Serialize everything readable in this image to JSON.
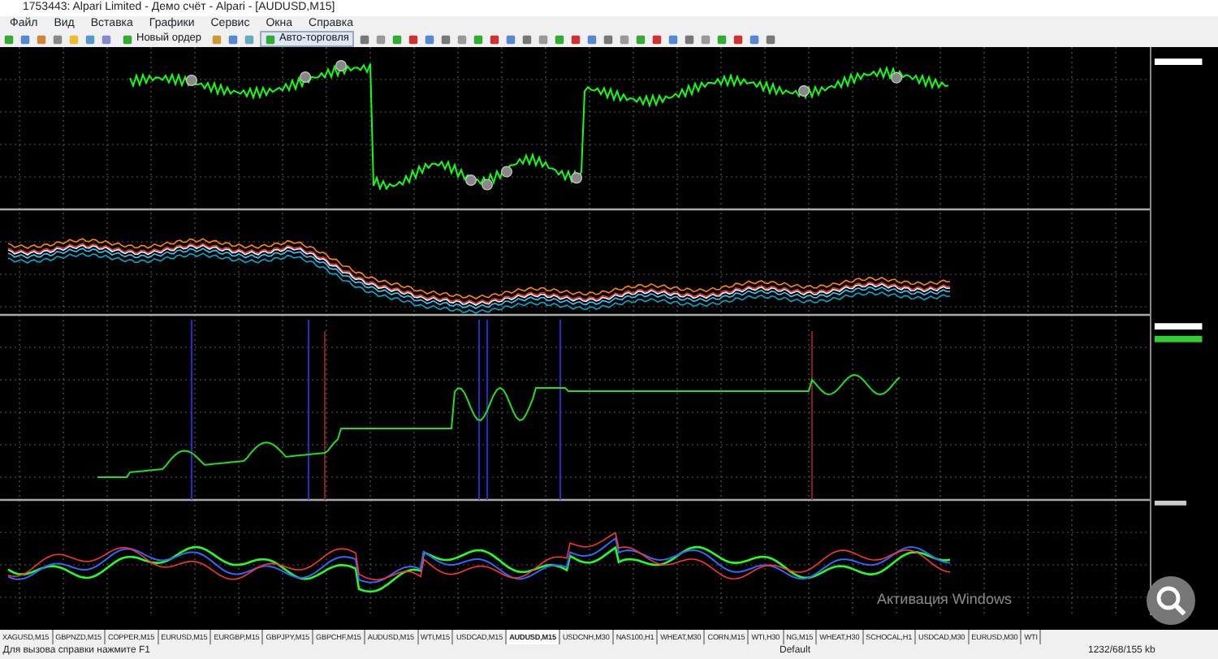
{
  "window": {
    "title": "1753443: Alpari Limited - Демо счёт - Alpari - [AUDUSD,M15]"
  },
  "menu": [
    "Файл",
    "Вид",
    "Вставка",
    "Графики",
    "Сервис",
    "Окна",
    "Справка"
  ],
  "toolbar": {
    "new_order": "Новый ордер",
    "auto_trading": "Авто-торговля",
    "auto_trading_on": true
  },
  "chart": {
    "panes": [
      {
        "kind": "price"
      },
      {
        "kind": "bands"
      },
      {
        "kind": "equity"
      },
      {
        "kind": "oscillator"
      }
    ],
    "overlay_text": "Активация Windows"
  },
  "tabs": [
    {
      "label": "XAGUSD,M15",
      "selected": false
    },
    {
      "label": "GBPNZD,M15",
      "selected": false
    },
    {
      "label": "COPPER,M15",
      "selected": false
    },
    {
      "label": "EURUSD,M15",
      "selected": false
    },
    {
      "label": "EURGBP,M15",
      "selected": false
    },
    {
      "label": "GBPJPY,M15",
      "selected": false
    },
    {
      "label": "GBPCHF,M15",
      "selected": false
    },
    {
      "label": "AUDUSD,M15",
      "selected": false
    },
    {
      "label": "WTI,M15",
      "selected": false
    },
    {
      "label": "USDCAD,M15",
      "selected": false
    },
    {
      "label": "AUDUSD,M15",
      "selected": true
    },
    {
      "label": "USDCNH,M30",
      "selected": false
    },
    {
      "label": "NAS100,H1",
      "selected": false
    },
    {
      "label": "WHEAT,M30",
      "selected": false
    },
    {
      "label": "CORN,M15",
      "selected": false
    },
    {
      "label": "WTI,H30",
      "selected": false
    },
    {
      "label": "NG,M15",
      "selected": false
    },
    {
      "label": "WHEAT,H30",
      "selected": false
    },
    {
      "label": "SCHOCAL,H1",
      "selected": false
    },
    {
      "label": "USDCAD,M30",
      "selected": false
    },
    {
      "label": "EURUSD,M30",
      "selected": false
    },
    {
      "label": "WTI",
      "selected": false
    }
  ],
  "status_bar": {
    "help": "Для вызова справки нажмите F1",
    "profile": "Default",
    "traffic": "1232/68/155 kb"
  }
}
